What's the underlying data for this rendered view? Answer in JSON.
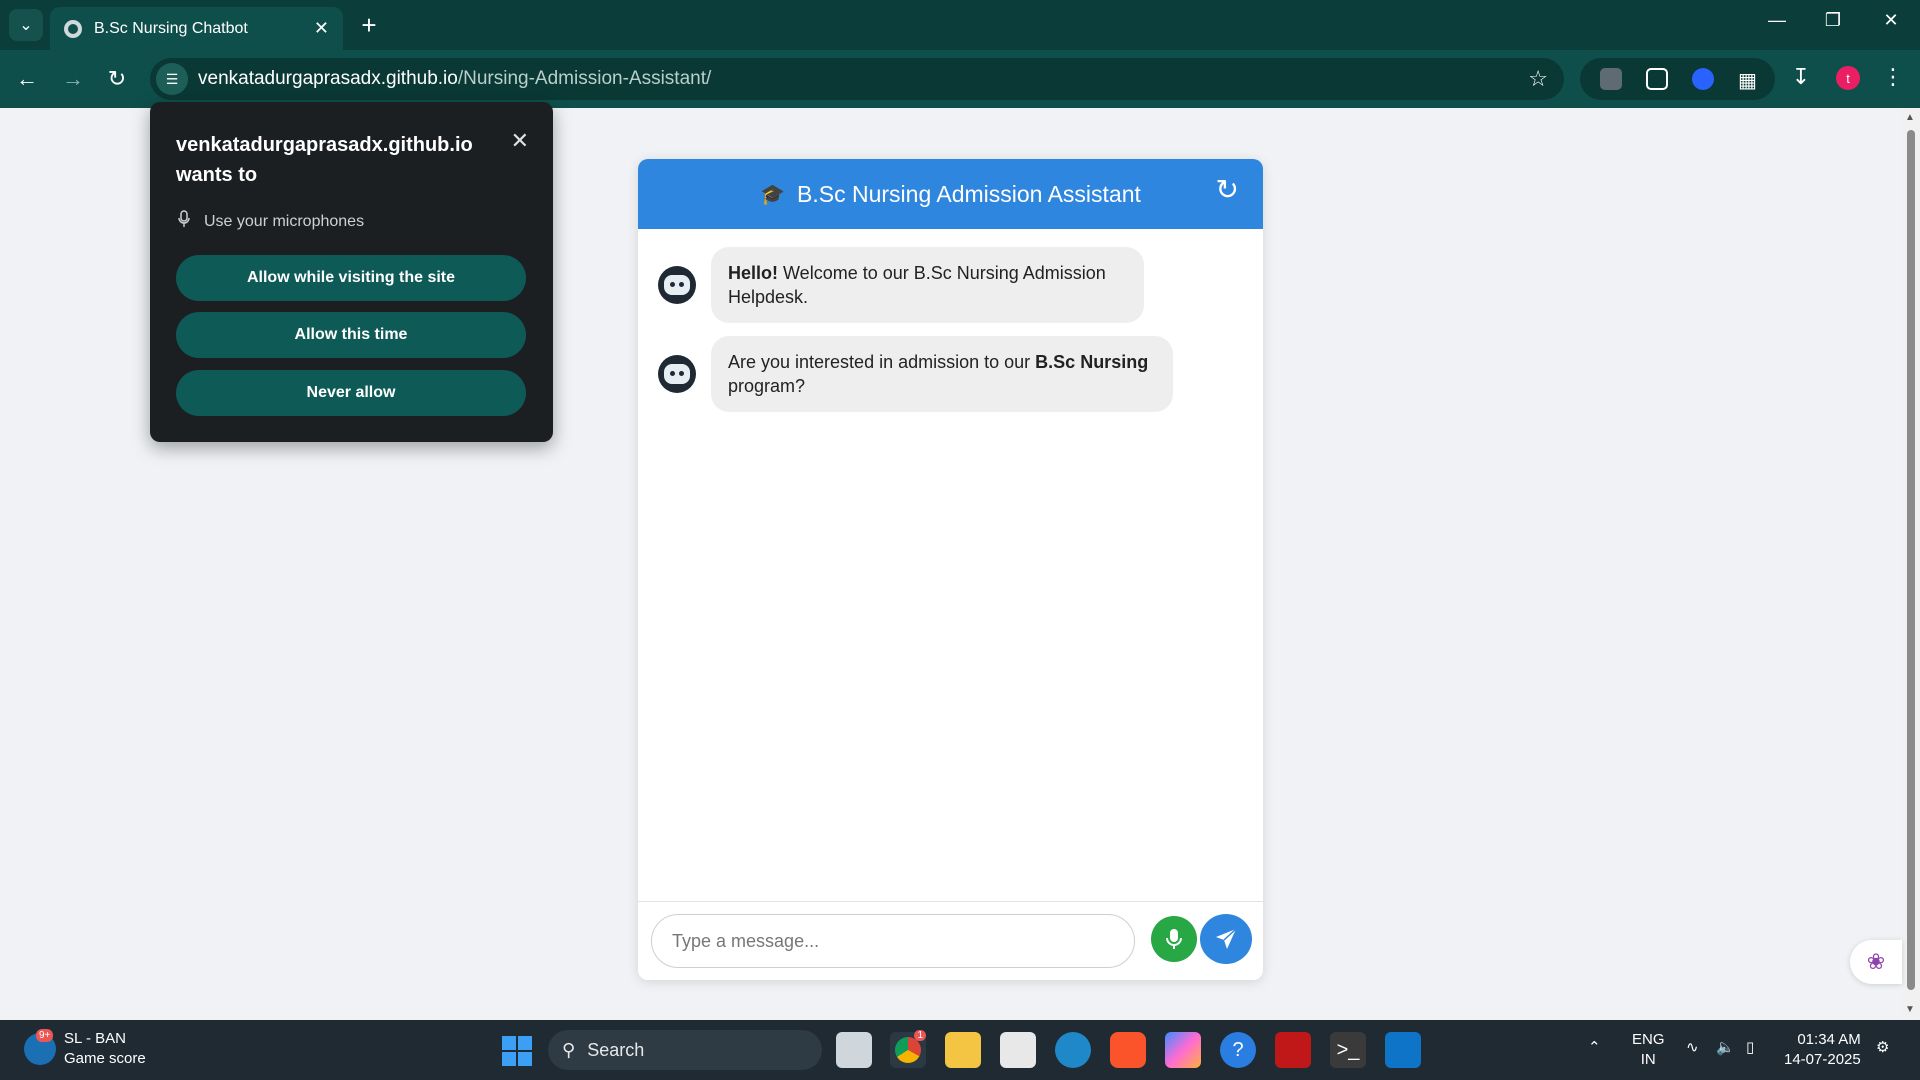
{
  "browser": {
    "tab_title": "B.Sc Nursing Chatbot",
    "url_host": "venkatadurgaprasadx.github.io",
    "url_path": "/Nursing-Admission-Assistant/",
    "profile_initial": "t"
  },
  "permission_popup": {
    "site": "venkatadurgaprasadx.github.io",
    "wants_to": "wants to",
    "permission": "Use your microphones",
    "allow_visiting": "Allow while visiting the site",
    "allow_once": "Allow this time",
    "never_allow": "Never allow"
  },
  "chat": {
    "title": "B.Sc Nursing Admission Assistant",
    "messages": [
      {
        "bold": "Hello!",
        "text_line1": " Welcome to our B.Sc Nursing Admission",
        "text_line2": "Helpdesk."
      },
      {
        "text_before": "Are you interested in admission to our ",
        "bold": "B.Sc Nursing",
        "text_line2": "program?"
      }
    ],
    "input_placeholder": "Type a message..."
  },
  "taskbar": {
    "widget_badge": "9+",
    "widget_title": "SL - BAN",
    "widget_subtitle": "Game score",
    "search_label": "Search",
    "chrome_badge": "1",
    "language": "ENG",
    "region": "IN",
    "time": "01:34 AM",
    "date": "14-07-2025"
  },
  "colors": {
    "chrome_frame": "#0b3d3a",
    "chat_header": "#2f86de",
    "mic_button": "#28a745",
    "popup_button": "#0e5a57"
  }
}
